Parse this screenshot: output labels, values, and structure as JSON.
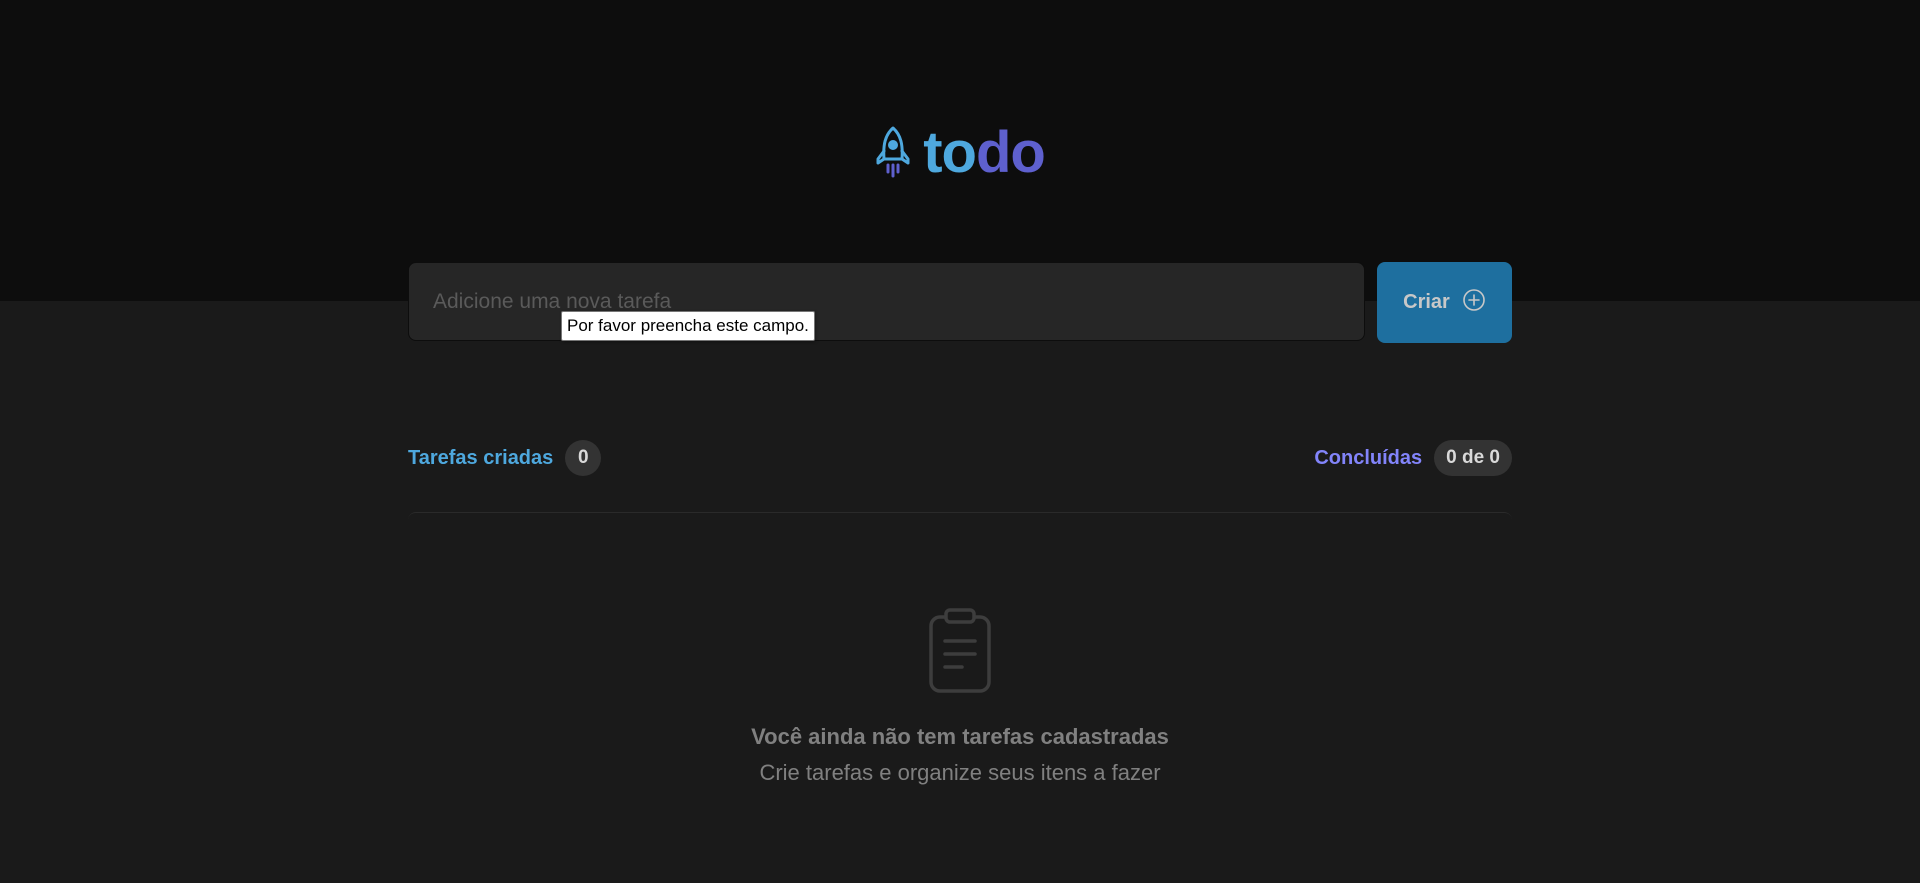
{
  "header": {
    "logo_part1": "to",
    "logo_part2": "do",
    "logo_icon": "rocket-icon"
  },
  "new_task": {
    "placeholder": "Adicione uma nova tarefa",
    "value": "",
    "create_label": "Criar",
    "create_icon": "plus-circle-icon",
    "validation_tooltip": "Por favor preencha este campo."
  },
  "counters": {
    "created_label": "Tarefas criadas",
    "created_count": "0",
    "done_label": "Concluídas",
    "done_count": "0 de 0"
  },
  "empty_state": {
    "icon": "clipboard-icon",
    "title": "Você ainda não tem tarefas cadastradas",
    "subtitle": "Crie tarefas e organize seus itens a fazer"
  },
  "colors": {
    "header_bg": "#0d0d0d",
    "page_bg": "#1a1a1a",
    "blue": "#4ea8de",
    "purple": "#5e60ce",
    "purple_light": "#8284fa",
    "button_bg": "#1e6f9f"
  }
}
